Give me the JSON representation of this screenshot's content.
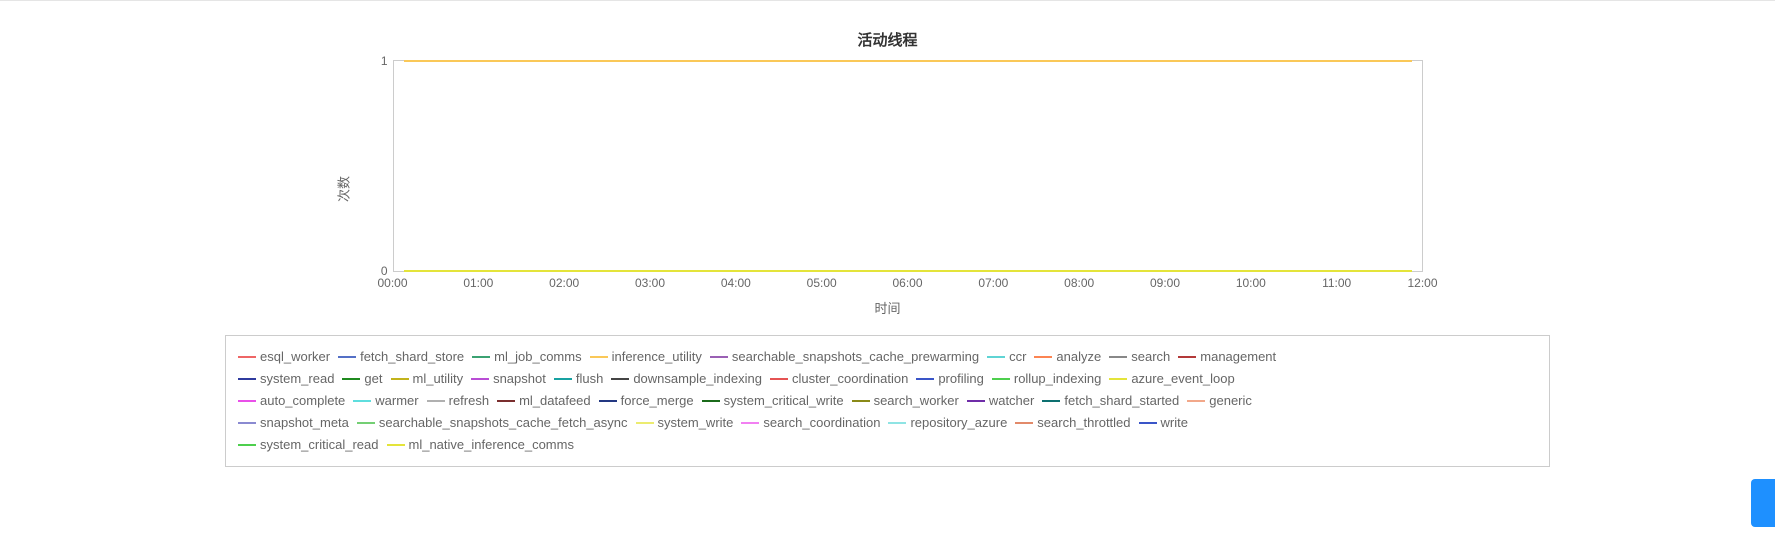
{
  "chart_data": {
    "type": "line",
    "title": "活动线程",
    "xlabel": "时间",
    "ylabel": "次数",
    "ylim": [
      0,
      1
    ],
    "x": [
      "00:00",
      "01:00",
      "02:00",
      "03:00",
      "04:00",
      "05:00",
      "06:00",
      "07:00",
      "08:00",
      "09:00",
      "10:00",
      "11:00",
      "12:00"
    ],
    "y_ticks": [
      0,
      1
    ],
    "series": [
      {
        "name": "esql_worker",
        "color": "#ee6666",
        "values": [
          0,
          0,
          0,
          0,
          0,
          0,
          0,
          0,
          0,
          0,
          0,
          0,
          0
        ]
      },
      {
        "name": "fetch_shard_store",
        "color": "#5470c6",
        "values": [
          0,
          0,
          0,
          0,
          0,
          0,
          0,
          0,
          0,
          0,
          0,
          0,
          0
        ]
      },
      {
        "name": "ml_job_comms",
        "color": "#3ba272",
        "values": [
          0,
          0,
          0,
          0,
          0,
          0,
          0,
          0,
          0,
          0,
          0,
          0,
          0
        ]
      },
      {
        "name": "inference_utility",
        "color": "#fac858",
        "values": [
          1,
          1,
          1,
          1,
          1,
          1,
          1,
          1,
          1,
          1,
          1,
          1,
          1
        ]
      },
      {
        "name": "searchable_snapshots_cache_prewarming",
        "color": "#9a60b4",
        "values": [
          0,
          0,
          0,
          0,
          0,
          0,
          0,
          0,
          0,
          0,
          0,
          0,
          0
        ]
      },
      {
        "name": "ccr",
        "color": "#5fd4d4",
        "values": [
          0,
          0,
          0,
          0,
          0,
          0,
          0,
          0,
          0,
          0,
          0,
          0,
          0
        ]
      },
      {
        "name": "analyze",
        "color": "#fc8452",
        "values": [
          0,
          0,
          0,
          0,
          0,
          0,
          0,
          0,
          0,
          0,
          0,
          0,
          0
        ]
      },
      {
        "name": "search",
        "color": "#888888",
        "values": [
          0,
          0,
          0,
          0,
          0,
          0,
          0,
          0,
          0,
          0,
          0,
          0,
          0
        ]
      },
      {
        "name": "management",
        "color": "#b33939",
        "values": [
          0,
          0,
          0,
          0,
          0,
          0,
          0,
          0,
          0,
          0,
          0,
          0,
          0
        ]
      },
      {
        "name": "system_read",
        "color": "#2f3b9e",
        "values": [
          0,
          0,
          0,
          0,
          0,
          0,
          0,
          0,
          0,
          0,
          0,
          0,
          0
        ]
      },
      {
        "name": "get",
        "color": "#1f8a1f",
        "values": [
          0,
          0,
          0,
          0,
          0,
          0,
          0,
          0,
          0,
          0,
          0,
          0,
          0
        ]
      },
      {
        "name": "ml_utility",
        "color": "#c2b31c",
        "values": [
          0,
          0,
          0,
          0,
          0,
          0,
          0,
          0,
          0,
          0,
          0,
          0,
          0
        ]
      },
      {
        "name": "snapshot",
        "color": "#b94dd5",
        "values": [
          0,
          0,
          0,
          0,
          0,
          0,
          0,
          0,
          0,
          0,
          0,
          0,
          0
        ]
      },
      {
        "name": "flush",
        "color": "#18a2a2",
        "values": [
          0,
          0,
          0,
          0,
          0,
          0,
          0,
          0,
          0,
          0,
          0,
          0,
          0
        ]
      },
      {
        "name": "downsample_indexing",
        "color": "#444444",
        "values": [
          0,
          0,
          0,
          0,
          0,
          0,
          0,
          0,
          0,
          0,
          0,
          0,
          0
        ]
      },
      {
        "name": "cluster_coordination",
        "color": "#e55353",
        "values": [
          0,
          0,
          0,
          0,
          0,
          0,
          0,
          0,
          0,
          0,
          0,
          0,
          0
        ]
      },
      {
        "name": "profiling",
        "color": "#3a55c8",
        "values": [
          0,
          0,
          0,
          0,
          0,
          0,
          0,
          0,
          0,
          0,
          0,
          0,
          0
        ]
      },
      {
        "name": "rollup_indexing",
        "color": "#4ecf4e",
        "values": [
          0,
          0,
          0,
          0,
          0,
          0,
          0,
          0,
          0,
          0,
          0,
          0,
          0
        ]
      },
      {
        "name": "azure_event_loop",
        "color": "#e4e43a",
        "values": [
          0,
          0,
          0,
          0,
          0,
          0,
          0,
          0,
          0,
          0,
          0,
          0,
          0
        ]
      },
      {
        "name": "auto_complete",
        "color": "#e950e9",
        "values": [
          0,
          0,
          0,
          0,
          0,
          0,
          0,
          0,
          0,
          0,
          0,
          0,
          0
        ]
      },
      {
        "name": "warmer",
        "color": "#5fdede",
        "values": [
          0,
          0,
          0,
          0,
          0,
          0,
          0,
          0,
          0,
          0,
          0,
          0,
          0
        ]
      },
      {
        "name": "refresh",
        "color": "#b0b0b0",
        "values": [
          0,
          0,
          0,
          0,
          0,
          0,
          0,
          0,
          0,
          0,
          0,
          0,
          0
        ]
      },
      {
        "name": "ml_datafeed",
        "color": "#7a2e2e",
        "values": [
          0,
          0,
          0,
          0,
          0,
          0,
          0,
          0,
          0,
          0,
          0,
          0,
          0
        ]
      },
      {
        "name": "force_merge",
        "color": "#233882",
        "values": [
          0,
          0,
          0,
          0,
          0,
          0,
          0,
          0,
          0,
          0,
          0,
          0,
          0
        ]
      },
      {
        "name": "system_critical_write",
        "color": "#1b6b1b",
        "values": [
          0,
          0,
          0,
          0,
          0,
          0,
          0,
          0,
          0,
          0,
          0,
          0,
          0
        ]
      },
      {
        "name": "search_worker",
        "color": "#8a8a18",
        "values": [
          0,
          0,
          0,
          0,
          0,
          0,
          0,
          0,
          0,
          0,
          0,
          0,
          0
        ]
      },
      {
        "name": "watcher",
        "color": "#6f2da8",
        "values": [
          0,
          0,
          0,
          0,
          0,
          0,
          0,
          0,
          0,
          0,
          0,
          0,
          0
        ]
      },
      {
        "name": "fetch_shard_started",
        "color": "#0d7070",
        "values": [
          0,
          0,
          0,
          0,
          0,
          0,
          0,
          0,
          0,
          0,
          0,
          0,
          0
        ]
      },
      {
        "name": "generic",
        "color": "#f2a88a",
        "values": [
          0,
          0,
          0,
          0,
          0,
          0,
          0,
          0,
          0,
          0,
          0,
          0,
          0
        ]
      },
      {
        "name": "snapshot_meta",
        "color": "#8a8ad1",
        "values": [
          0,
          0,
          0,
          0,
          0,
          0,
          0,
          0,
          0,
          0,
          0,
          0,
          0
        ]
      },
      {
        "name": "searchable_snapshots_cache_fetch_async",
        "color": "#74cf74",
        "values": [
          0,
          0,
          0,
          0,
          0,
          0,
          0,
          0,
          0,
          0,
          0,
          0,
          0
        ]
      },
      {
        "name": "system_write",
        "color": "#ecec70",
        "values": [
          0,
          0,
          0,
          0,
          0,
          0,
          0,
          0,
          0,
          0,
          0,
          0,
          0
        ]
      },
      {
        "name": "search_coordination",
        "color": "#f280f2",
        "values": [
          0,
          0,
          0,
          0,
          0,
          0,
          0,
          0,
          0,
          0,
          0,
          0,
          0
        ]
      },
      {
        "name": "repository_azure",
        "color": "#8fe4e4",
        "values": [
          0,
          0,
          0,
          0,
          0,
          0,
          0,
          0,
          0,
          0,
          0,
          0,
          0
        ]
      },
      {
        "name": "search_throttled",
        "color": "#e28a6a",
        "values": [
          0,
          0,
          0,
          0,
          0,
          0,
          0,
          0,
          0,
          0,
          0,
          0,
          0
        ]
      },
      {
        "name": "write",
        "color": "#3a55c8",
        "values": [
          0,
          0,
          0,
          0,
          0,
          0,
          0,
          0,
          0,
          0,
          0,
          0,
          0
        ]
      },
      {
        "name": "system_critical_read",
        "color": "#4ecf4e",
        "values": [
          0,
          0,
          0,
          0,
          0,
          0,
          0,
          0,
          0,
          0,
          0,
          0,
          0
        ]
      },
      {
        "name": "ml_native_inference_comms",
        "color": "#e4e43a",
        "values": [
          0,
          0,
          0,
          0,
          0,
          0,
          0,
          0,
          0,
          0,
          0,
          0,
          0
        ]
      }
    ],
    "legend_rows": [
      [
        "esql_worker",
        "fetch_shard_store",
        "ml_job_comms",
        "inference_utility",
        "searchable_snapshots_cache_prewarming",
        "ccr",
        "analyze",
        "search",
        "management"
      ],
      [
        "system_read",
        "get",
        "ml_utility",
        "snapshot",
        "flush",
        "downsample_indexing",
        "cluster_coordination",
        "profiling",
        "rollup_indexing",
        "azure_event_loop"
      ],
      [
        "auto_complete",
        "warmer",
        "refresh",
        "ml_datafeed",
        "force_merge",
        "system_critical_write",
        "search_worker",
        "watcher",
        "fetch_shard_started",
        "generic"
      ],
      [
        "snapshot_meta",
        "searchable_snapshots_cache_fetch_async",
        "system_write",
        "search_coordination",
        "repository_azure",
        "search_throttled",
        "write"
      ],
      [
        "system_critical_read",
        "ml_native_inference_comms"
      ]
    ]
  }
}
